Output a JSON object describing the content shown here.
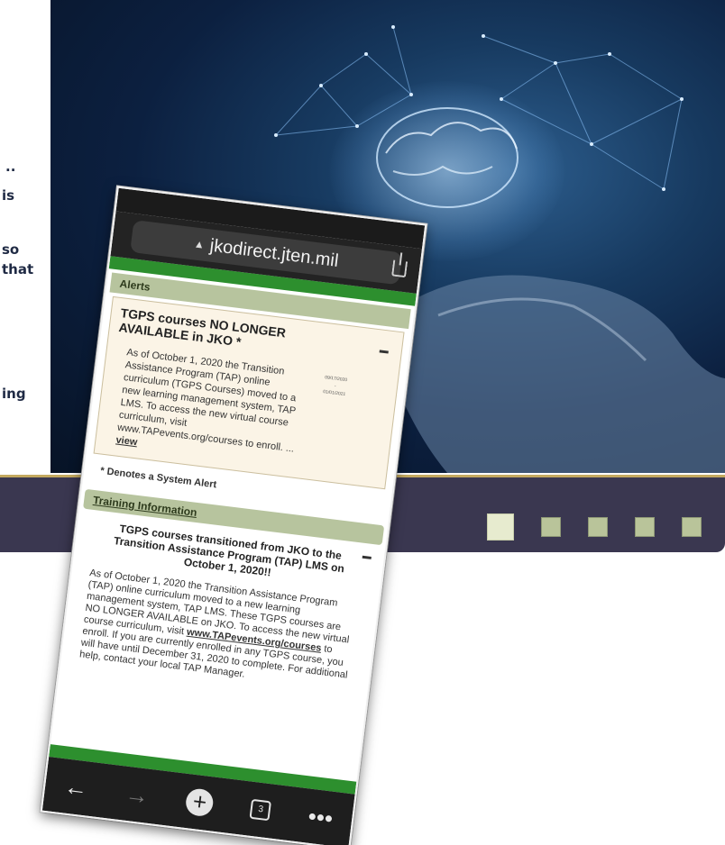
{
  "left_panel": {
    "fragments": [
      "..",
      "is",
      "so",
      "that",
      "ing"
    ]
  },
  "hero": {
    "description_colors": {
      "deep": "#071326",
      "mid": "#173a60",
      "glow": "#bfe1ff"
    }
  },
  "slider": {
    "dot_count": 5,
    "active_index": 0,
    "colors": {
      "bar": "#3a3750",
      "accent_line": "#c3a95f",
      "dot": "#b9c49a",
      "active_dot": "#e7ebcf"
    }
  },
  "phone": {
    "url": "jkodirect.jten.mil",
    "alerts_label": "Alerts",
    "alert": {
      "title": "TGPS courses NO LONGER AVAILABLE in JKO *",
      "body": "As of October 1, 2020 the Transition Assistance Program (TAP) online curriculum (TGPS Courses) moved to a new learning management system, TAP LMS. To access the new virtual course curriculum, visit www.TAPevents.org/courses to enroll. ...",
      "link": "view",
      "date_start": "09/17/2020",
      "date_end": "01/01/2021"
    },
    "footnote": "* Denotes a System Alert",
    "training_label": "Training Information",
    "training": {
      "title": "TGPS courses transitioned from JKO to the Transition Assistance Program (TAP) LMS on October 1, 2020!!",
      "body_part1": "As of October 1, 2020 the Transition Assistance Program (TAP) online curriculum moved to a new learning management system, TAP LMS. These TGPS courses are NO LONGER AVAILABLE on JKO. To access the new virtual course curriculum, visit ",
      "body_link": "www.TAPevents.org/courses",
      "body_part2": " to enroll. If you are currently enrolled in any TGPS course, you will have until December 31, 2020 to complete. For additional help, contact your local TAP Manager."
    },
    "tab_count": "3",
    "colors": {
      "green_strip": "#2d8f2e",
      "section": "#b7c49e",
      "alert_bg": "#fbf4e6"
    }
  }
}
